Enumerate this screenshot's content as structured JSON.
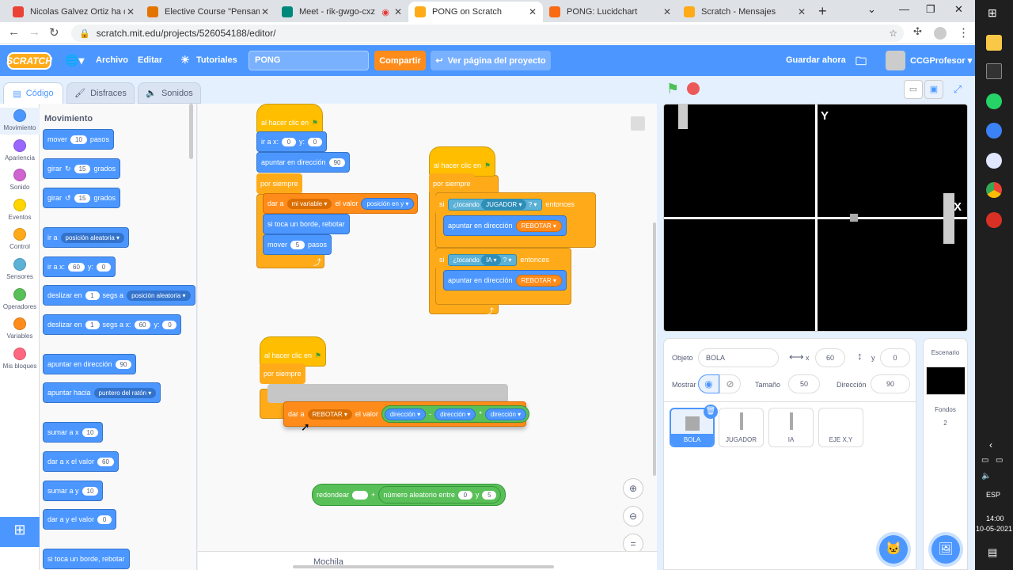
{
  "browser": {
    "tabs": [
      {
        "title": "Nicolas Galvez Ortiz ha com",
        "color": "#ea4335"
      },
      {
        "title": "Elective Course \"Pensamien",
        "color": "#e37400"
      },
      {
        "title": "Meet - rik-gwgo-cxz",
        "color": "#00897b"
      },
      {
        "title": "PONG on Scratch",
        "color": "#ffab19"
      },
      {
        "title": "PONG: Lucidchart",
        "color": "#f96b13"
      },
      {
        "title": "Scratch - Mensajes",
        "color": "#ffab19"
      }
    ],
    "url": "scratch.mit.edu/projects/526054188/editor/"
  },
  "menubar": {
    "logo": "SCRATCH",
    "archivo": "Archivo",
    "editar": "Editar",
    "tutoriales": "Tutoriales",
    "project_name": "PONG",
    "share": "Compartir",
    "view_page": "Ver página del proyecto",
    "save_now": "Guardar ahora",
    "username": "CCGProfesor"
  },
  "editor_tabs": {
    "code": "Código",
    "costumes": "Disfraces",
    "sounds": "Sonidos"
  },
  "categories": [
    {
      "label": "Movimiento",
      "color": "#4c97ff"
    },
    {
      "label": "Apariencia",
      "color": "#9966ff"
    },
    {
      "label": "Sonido",
      "color": "#cf63cf"
    },
    {
      "label": "Eventos",
      "color": "#ffd500"
    },
    {
      "label": "Control",
      "color": "#ffab19"
    },
    {
      "label": "Sensores",
      "color": "#5cb1d6"
    },
    {
      "label": "Operadores",
      "color": "#59c059"
    },
    {
      "label": "Variables",
      "color": "#ff8c1a"
    },
    {
      "label": "Mis bloques",
      "color": "#ff6680"
    }
  ],
  "palette": {
    "heading": "Movimiento",
    "mover": "mover",
    "mover_val": "10",
    "pasos": "pasos",
    "girar": "girar",
    "girar_r_val": "15",
    "girar_l_val": "15",
    "grados": "grados",
    "ir_a": "ir a",
    "posicion_aleatoria": "posición aleatoria",
    "ir_a_x": "ir a x:",
    "x_val": "60",
    "y_lbl": "y:",
    "y_val": "0",
    "deslizar_en": "deslizar en",
    "one": "1",
    "segs_a": "segs a",
    "segs_a_x": "segs a x:",
    "apuntar_dir": "apuntar en dirección",
    "dir_val": "90",
    "apuntar_hacia": "apuntar hacia",
    "puntero": "puntero del ratón",
    "sumar_x": "sumar a x",
    "sumar_x_val": "10",
    "dar_x": "dar a x el valor",
    "dar_x_val": "60",
    "sumar_y": "sumar a y",
    "sumar_y_val": "10",
    "dar_y": "dar a y el valor",
    "dar_y_val": "0",
    "rebotar": "si toca un borde, rebotar"
  },
  "script1": {
    "hat": "al hacer clic en",
    "ir_a_x": "ir a x:",
    "x": "0",
    "y_lbl": "y:",
    "y": "0",
    "apuntar": "apuntar en dirección",
    "dir": "90",
    "forever": "por siempre",
    "dar_a": "dar a",
    "var": "mi variable",
    "el_valor": "el valor",
    "valor": "posición en y",
    "rebotar": "si toca un borde, rebotar",
    "mover": "mover",
    "pasos_val": "5",
    "pasos": "pasos"
  },
  "script2": {
    "hat": "al hacer clic en",
    "forever": "por siempre",
    "si": "si",
    "tocando": "¿tocando",
    "jugador": "JUGADOR",
    "q": "?",
    "entonces": "entonces",
    "apuntar": "apuntar en dirección",
    "rebotar_var": "REBOTAR",
    "ia": "IA"
  },
  "script3": {
    "hat": "al hacer clic en",
    "forever": "por siempre",
    "dar_a": "dar a",
    "var": "REBOTAR",
    "el_valor": "el valor",
    "dir": "dirección",
    "minus": "-",
    "times": "*"
  },
  "loose": {
    "redondear": "redondear",
    "plus": "+",
    "aleatorio": "número aleatorio entre",
    "a": "0",
    "y": "y",
    "b": "5"
  },
  "mochila": "Mochila",
  "stage": {
    "label_y": "Y",
    "label_x": "X"
  },
  "sprite_info": {
    "objeto_lbl": "Objeto",
    "objeto": "BOLA",
    "x_lbl": "x",
    "x": "60",
    "y_lbl": "y",
    "y": "0",
    "mostrar": "Mostrar",
    "tamano_lbl": "Tamaño",
    "tamano": "50",
    "direccion_lbl": "Dirección",
    "direccion": "90"
  },
  "sprites": [
    "BOLA",
    "JUGADOR",
    "IA",
    "EJE X,Y"
  ],
  "scenario": {
    "title": "Escenario",
    "fondos": "Fondos",
    "fondos_count": "2"
  },
  "taskbar": {
    "lang": "ESP",
    "time": "14:00",
    "date": "10-05-2021"
  }
}
